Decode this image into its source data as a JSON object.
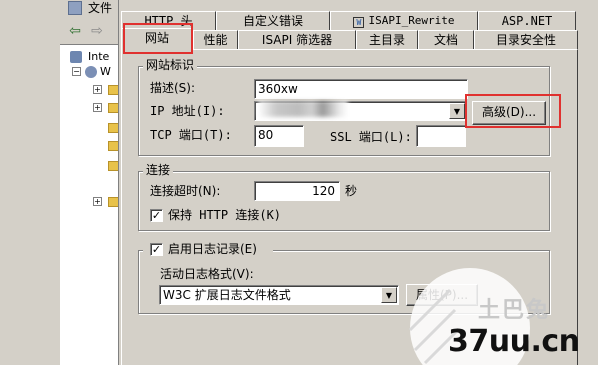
{
  "app": {
    "menu_file": "文件",
    "tree_root_label": "Inte",
    "tree_child_label": "W"
  },
  "tabs": {
    "back_row": [
      "HTTP 头",
      "自定义错误",
      "ISAPI_Rewrite",
      "ASP.NET"
    ],
    "front_row": [
      "网站",
      "性能",
      "ISAPI 筛选器",
      "主目录",
      "文档",
      "目录安全性"
    ],
    "selected": "网站"
  },
  "website_id": {
    "title": "网站标识",
    "description_label": "描述(S):",
    "description_value": "360xw",
    "ip_label": "IP 地址(I):",
    "ip_value": "",
    "advanced_button": "高级(D)...",
    "tcp_label": "TCP 端口(T):",
    "tcp_value": "80",
    "ssl_label": "SSL 端口(L):",
    "ssl_value": ""
  },
  "connection": {
    "title": "连接",
    "timeout_label": "连接超时(N):",
    "timeout_value": "120",
    "timeout_unit": "秒",
    "keepalive_label": "保持 HTTP 连接(K)",
    "keepalive_checked": true
  },
  "logging": {
    "enable_label": "启用日志记录(E)",
    "enable_checked": true,
    "format_label": "活动日志格式(V):",
    "format_value": "W3C 扩展日志文件格式",
    "properties_button": "属性(P)..."
  },
  "watermark": {
    "text": "37uu.cn",
    "faint_text": "土巴兔"
  },
  "colors": {
    "highlight_red": "#e0312f",
    "dialog_bg": "#d4d0c8"
  }
}
